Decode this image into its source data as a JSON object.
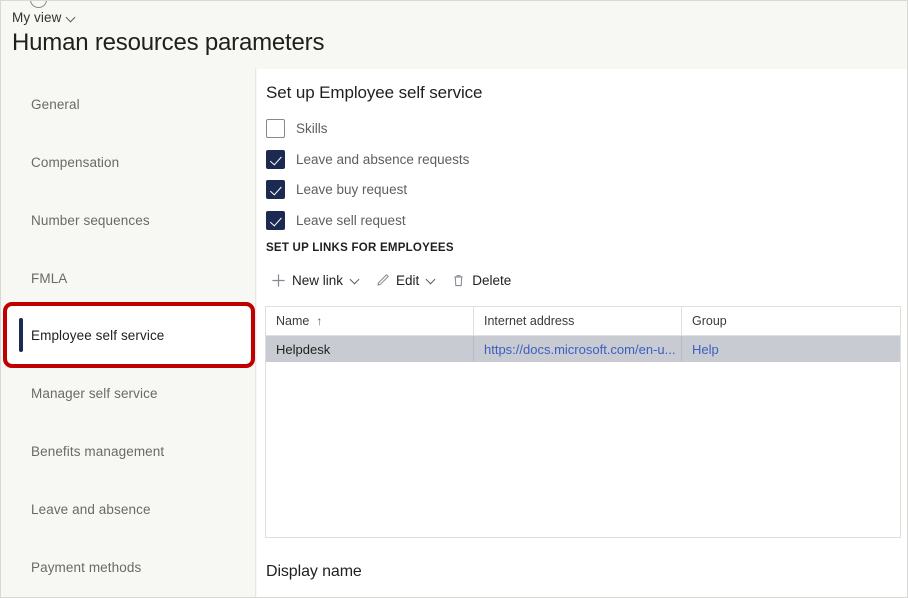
{
  "header": {
    "view_selector_label": "My view",
    "view_selector_icon": "chevron-down-icon",
    "page_title": "Human resources parameters"
  },
  "sidebar": {
    "items": [
      {
        "label": "General",
        "selected": false
      },
      {
        "label": "Compensation",
        "selected": false
      },
      {
        "label": "Number sequences",
        "selected": false
      },
      {
        "label": "FMLA",
        "selected": false
      },
      {
        "label": "Employee self service",
        "selected": true
      },
      {
        "label": "Manager self service",
        "selected": false
      },
      {
        "label": "Benefits management",
        "selected": false
      },
      {
        "label": "Leave and absence",
        "selected": false
      },
      {
        "label": "Payment methods",
        "selected": false
      }
    ],
    "highlight_color": "#c00000",
    "selection_bar_color": "#1c2a52"
  },
  "main": {
    "section_title": "Set up Employee self service",
    "checkboxes": [
      {
        "label": "Skills",
        "checked": false
      },
      {
        "label": "Leave and absence requests",
        "checked": true
      },
      {
        "label": "Leave buy request",
        "checked": true
      },
      {
        "label": "Leave sell request",
        "checked": true
      }
    ],
    "links_caption": "SET UP LINKS FOR EMPLOYEES",
    "toolbar": [
      {
        "label": "New link",
        "icon": "plus-icon",
        "has_chevron": true
      },
      {
        "label": "Edit",
        "icon": "pencil-icon",
        "has_chevron": true
      },
      {
        "label": "Delete",
        "icon": "trash-icon",
        "has_chevron": false
      }
    ],
    "grid": {
      "columns": [
        {
          "header": "Name",
          "sort": "ascending",
          "sort_glyph": "↑"
        },
        {
          "header": "Internet address",
          "sort": "",
          "sort_glyph": ""
        },
        {
          "header": "Group",
          "sort": "",
          "sort_glyph": ""
        }
      ],
      "rows": [
        {
          "name": "Helpdesk",
          "internet_address": "https://docs.microsoft.com/en-u...",
          "group": "Help",
          "selected": true
        }
      ],
      "selected_row_color": "#c9cbd3"
    },
    "display_name_label": "Display name"
  }
}
